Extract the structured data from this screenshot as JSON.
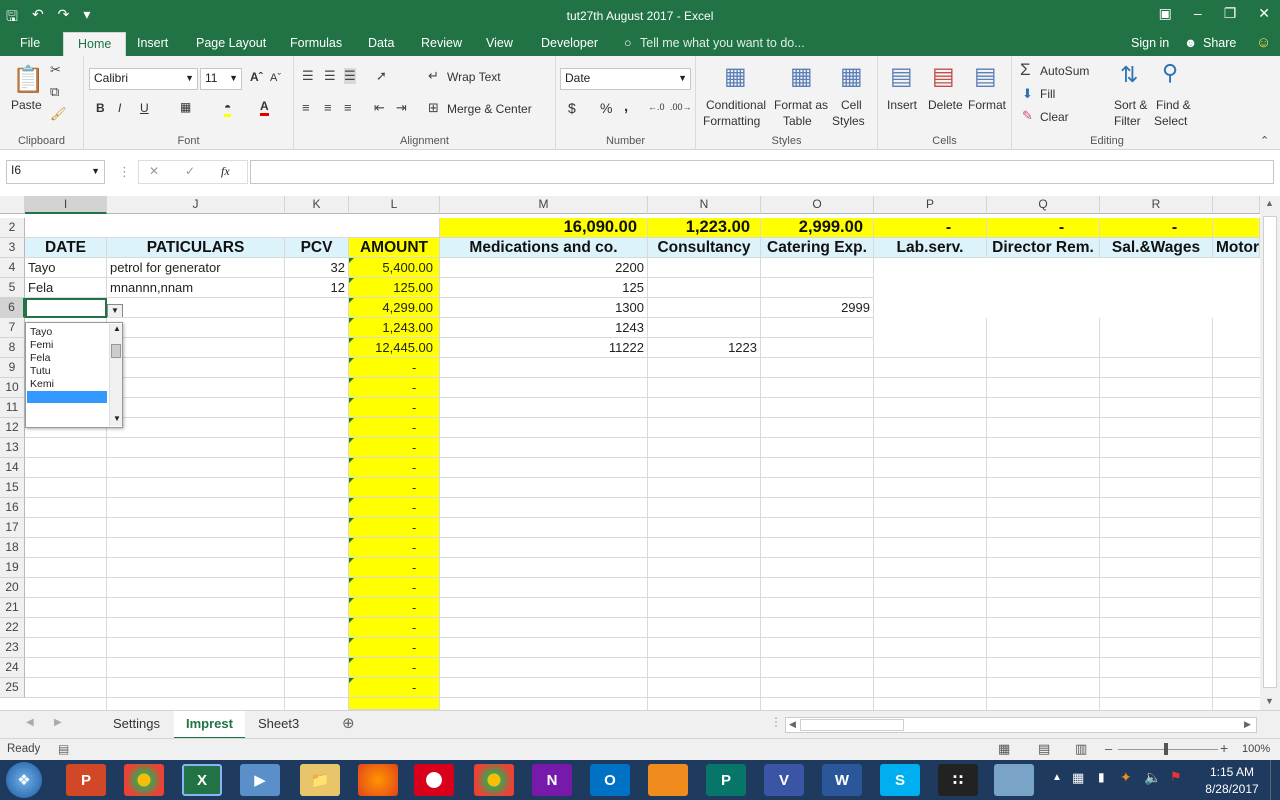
{
  "window": {
    "title": "tut27th August 2017 - Excel"
  },
  "ribbon_tabs": [
    "File",
    "Home",
    "Insert",
    "Page Layout",
    "Formulas",
    "Data",
    "Review",
    "View",
    "Developer"
  ],
  "tell_me": "Tell me what you want to do...",
  "sign_in": "Sign in",
  "share": "Share",
  "clipboard": {
    "paste": "Paste",
    "label": "Clipboard"
  },
  "font": {
    "name": "Calibri",
    "size": "11",
    "label": "Font"
  },
  "alignment": {
    "wrap": "Wrap Text",
    "merge": "Merge & Center",
    "label": "Alignment"
  },
  "number": {
    "format": "Date",
    "label": "Number",
    "currency": "$",
    "percent": "%",
    "comma": ","
  },
  "styles": {
    "cond1": "Conditional",
    "cond2": "Formatting",
    "fmt1": "Format as",
    "fmt2": "Table",
    "cell1": "Cell",
    "cell2": "Styles",
    "label": "Styles"
  },
  "cells": {
    "insert": "Insert",
    "delete": "Delete",
    "format": "Format",
    "label": "Cells"
  },
  "editing": {
    "autosum": "AutoSum",
    "fill": "Fill",
    "clear": "Clear",
    "sort1": "Sort &",
    "sort2": "Filter",
    "find1": "Find &",
    "find2": "Select",
    "label": "Editing"
  },
  "formula_bar": {
    "name_box": "I6",
    "fx": "fx",
    "value": ""
  },
  "columns": [
    "I",
    "J",
    "K",
    "L",
    "M",
    "N",
    "O",
    "P",
    "Q",
    "R"
  ],
  "rows": [
    "2",
    "3",
    "4",
    "5",
    "6",
    "7",
    "8",
    "9",
    "10",
    "11",
    "12",
    "13",
    "14",
    "15",
    "16",
    "17",
    "18",
    "19",
    "20",
    "21",
    "22",
    "23",
    "24",
    "25"
  ],
  "totals": {
    "M": "16,090.00",
    "N": "1,223.00",
    "O": "2,999.00",
    "P": "-",
    "Q": "-",
    "R": "-"
  },
  "headers": {
    "I": "DATE",
    "J": "PATICULARS",
    "K": "PCV",
    "L": "AMOUNT",
    "M": "Medications and co.",
    "N": "Consultancy",
    "O": "Catering Exp.",
    "P": "Lab.serv.",
    "Q": "Director Rem.",
    "R": "Sal.&Wages",
    "S": "Motor"
  },
  "data_rows": [
    {
      "I": "Tayo",
      "J": "petrol for generator",
      "K": "32",
      "L": "5,400.00",
      "M": "2200",
      "N": "",
      "O": ""
    },
    {
      "I": "Fela",
      "J": "mnannn,nnam",
      "K": "12",
      "L": "125.00",
      "M": "125",
      "N": "",
      "O": ""
    },
    {
      "I": "",
      "J": "",
      "K": "",
      "L": "4,299.00",
      "M": "1300",
      "N": "",
      "O": "2999"
    },
    {
      "I": "",
      "J": "",
      "K": "",
      "L": "1,243.00",
      "M": "1243",
      "N": "",
      "O": ""
    },
    {
      "I": "",
      "J": "",
      "K": "",
      "L": "12,445.00",
      "M": "11222",
      "N": "1223",
      "O": ""
    }
  ],
  "dash": "-",
  "dropdown_options": [
    "Tayo",
    "Femi",
    "Fela",
    "Tutu",
    "Kemi"
  ],
  "sheets": [
    "Settings",
    "Imprest",
    "Sheet3"
  ],
  "status": {
    "ready": "Ready",
    "zoom": "100%"
  },
  "clock": {
    "time": "1:15 AM",
    "date": "8/28/2017"
  }
}
